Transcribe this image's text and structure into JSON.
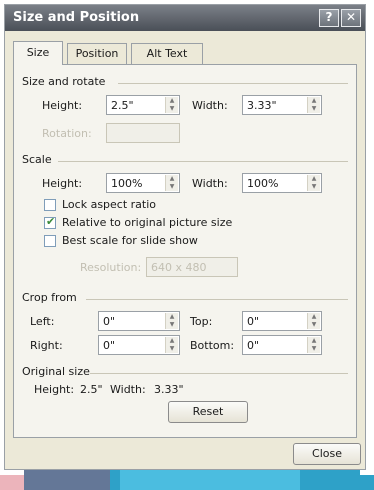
{
  "dialog": {
    "title": "Size and Position",
    "help_glyph": "?",
    "close_glyph": "✕",
    "close_label": "Close"
  },
  "tabs": [
    {
      "label": "Size",
      "active": true
    },
    {
      "label": "Position",
      "active": false
    },
    {
      "label": "Alt Text",
      "active": false
    }
  ],
  "size_rotate": {
    "heading": "Size and rotate",
    "height_label": "Height:",
    "height_value": "2.5\"",
    "width_label": "Width:",
    "width_value": "3.33\"",
    "rotation_label": "Rotation:"
  },
  "scale": {
    "heading": "Scale",
    "height_label": "Height:",
    "height_value": "100%",
    "width_label": "Width:",
    "width_value": "100%",
    "lock_aspect": {
      "label": "Lock aspect ratio",
      "checked": false
    },
    "relative_original": {
      "label": "Relative to original picture size",
      "checked": true
    },
    "best_scale": {
      "label": "Best scale for slide show",
      "checked": false
    },
    "resolution_label": "Resolution:",
    "resolution_value": "640 x 480"
  },
  "crop": {
    "heading": "Crop from",
    "left_label": "Left:",
    "left_value": "0\"",
    "top_label": "Top:",
    "top_value": "0\"",
    "right_label": "Right:",
    "right_value": "0\"",
    "bottom_label": "Bottom:",
    "bottom_value": "0\""
  },
  "original": {
    "heading": "Original size",
    "height_label": "Height:",
    "height_value": "2.5\"",
    "width_label": "Width:",
    "width_value": "3.33\"",
    "reset_label": "Reset"
  }
}
